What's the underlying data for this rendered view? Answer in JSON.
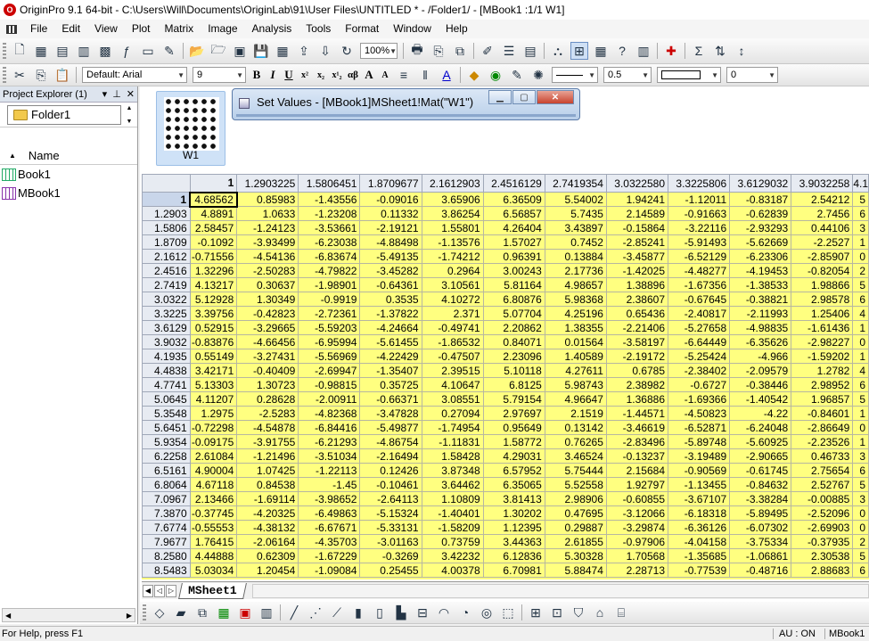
{
  "window": {
    "title": "OriginPro 9.1 64-bit - C:\\Users\\Will\\Documents\\OriginLab\\91\\User Files\\UNTITLED * - /Folder1/ - [MBook1 :1/1 W1]"
  },
  "menu": {
    "items": [
      "File",
      "Edit",
      "View",
      "Plot",
      "Matrix",
      "Image",
      "Analysis",
      "Tools",
      "Format",
      "Window",
      "Help"
    ]
  },
  "toolbar": {
    "zoom": "100%",
    "font": "Default: Arial",
    "font_size": "9",
    "line_width": "0.5",
    "combo_last": "0"
  },
  "project_explorer": {
    "title": "Project Explorer (1)",
    "folder": "Folder1",
    "column_header": "Name",
    "items": [
      {
        "name": "Book1",
        "type": "workbook"
      },
      {
        "name": "MBook1",
        "type": "matrixbook"
      }
    ]
  },
  "thumbnail": {
    "label": "W1"
  },
  "dialog": {
    "title": "Set Values - [MBook1]MSheet1!Mat(\"W1\")"
  },
  "matrix": {
    "column_headers": [
      "1",
      "1.2903225",
      "1.5806451",
      "1.8709677",
      "2.1612903",
      "2.4516129",
      "2.7419354",
      "3.0322580",
      "3.3225806",
      "3.6129032",
      "3.9032258",
      "4.1"
    ],
    "rows": [
      {
        "head": "1",
        "cells": [
          "4.68562",
          "0.85983",
          "-1.43556",
          "-0.09016",
          "3.65906",
          "6.36509",
          "5.54002",
          "1.94241",
          "-1.12011",
          "-0.83187",
          "2.54212",
          "5"
        ]
      },
      {
        "head": "1.2903",
        "cells": [
          "4.8891",
          "1.0633",
          "-1.23208",
          "0.11332",
          "3.86254",
          "6.56857",
          "5.7435",
          "2.14589",
          "-0.91663",
          "-0.62839",
          "2.7456",
          "6"
        ]
      },
      {
        "head": "1.5806",
        "cells": [
          "2.58457",
          "-1.24123",
          "-3.53661",
          "-2.19121",
          "1.55801",
          "4.26404",
          "3.43897",
          "-0.15864",
          "-3.22116",
          "-2.93293",
          "0.44106",
          "3"
        ]
      },
      {
        "head": "1.8709",
        "cells": [
          "-0.1092",
          "-3.93499",
          "-6.23038",
          "-4.88498",
          "-1.13576",
          "1.57027",
          "0.7452",
          "-2.85241",
          "-5.91493",
          "-5.62669",
          "-2.2527",
          "1"
        ]
      },
      {
        "head": "2.1612",
        "cells": [
          "-0.71556",
          "-4.54136",
          "-6.83674",
          "-5.49135",
          "-1.74212",
          "0.96391",
          "0.13884",
          "-3.45877",
          "-6.52129",
          "-6.23306",
          "-2.85907",
          "0"
        ]
      },
      {
        "head": "2.4516",
        "cells": [
          "1.32296",
          "-2.50283",
          "-4.79822",
          "-3.45282",
          "0.2964",
          "3.00243",
          "2.17736",
          "-1.42025",
          "-4.48277",
          "-4.19453",
          "-0.82054",
          "2"
        ]
      },
      {
        "head": "2.7419",
        "cells": [
          "4.13217",
          "0.30637",
          "-1.98901",
          "-0.64361",
          "3.10561",
          "5.81164",
          "4.98657",
          "1.38896",
          "-1.67356",
          "-1.38533",
          "1.98866",
          "5"
        ]
      },
      {
        "head": "3.0322",
        "cells": [
          "5.12928",
          "1.30349",
          "-0.9919",
          "0.3535",
          "4.10272",
          "6.80876",
          "5.98368",
          "2.38607",
          "-0.67645",
          "-0.38821",
          "2.98578",
          "6"
        ]
      },
      {
        "head": "3.3225",
        "cells": [
          "3.39756",
          "-0.42823",
          "-2.72361",
          "-1.37822",
          "2.371",
          "5.07704",
          "4.25196",
          "0.65436",
          "-2.40817",
          "-2.11993",
          "1.25406",
          "4"
        ]
      },
      {
        "head": "3.6129",
        "cells": [
          "0.52915",
          "-3.29665",
          "-5.59203",
          "-4.24664",
          "-0.49741",
          "2.20862",
          "1.38355",
          "-2.21406",
          "-5.27658",
          "-4.98835",
          "-1.61436",
          "1"
        ]
      },
      {
        "head": "3.9032",
        "cells": [
          "-0.83876",
          "-4.66456",
          "-6.95994",
          "-5.61455",
          "-1.86532",
          "0.84071",
          "0.01564",
          "-3.58197",
          "-6.64449",
          "-6.35626",
          "-2.98227",
          "0"
        ]
      },
      {
        "head": "4.1935",
        "cells": [
          "0.55149",
          "-3.27431",
          "-5.56969",
          "-4.22429",
          "-0.47507",
          "2.23096",
          "1.40589",
          "-2.19172",
          "-5.25424",
          "-4.966",
          "-1.59202",
          "1"
        ]
      },
      {
        "head": "4.4838",
        "cells": [
          "3.42171",
          "-0.40409",
          "-2.69947",
          "-1.35407",
          "2.39515",
          "5.10118",
          "4.27611",
          "0.6785",
          "-2.38402",
          "-2.09579",
          "1.2782",
          "4"
        ]
      },
      {
        "head": "4.7741",
        "cells": [
          "5.13303",
          "1.30723",
          "-0.98815",
          "0.35725",
          "4.10647",
          "6.8125",
          "5.98743",
          "2.38982",
          "-0.6727",
          "-0.38446",
          "2.98952",
          "6"
        ]
      },
      {
        "head": "5.0645",
        "cells": [
          "4.11207",
          "0.28628",
          "-2.00911",
          "-0.66371",
          "3.08551",
          "5.79154",
          "4.96647",
          "1.36886",
          "-1.69366",
          "-1.40542",
          "1.96857",
          "5"
        ]
      },
      {
        "head": "5.3548",
        "cells": [
          "1.2975",
          "-2.5283",
          "-4.82368",
          "-3.47828",
          "0.27094",
          "2.97697",
          "2.1519",
          "-1.44571",
          "-4.50823",
          "-4.22",
          "-0.84601",
          "1"
        ]
      },
      {
        "head": "5.6451",
        "cells": [
          "-0.72298",
          "-4.54878",
          "-6.84416",
          "-5.49877",
          "-1.74954",
          "0.95649",
          "0.13142",
          "-3.46619",
          "-6.52871",
          "-6.24048",
          "-2.86649",
          "0"
        ]
      },
      {
        "head": "5.9354",
        "cells": [
          "-0.09175",
          "-3.91755",
          "-6.21293",
          "-4.86754",
          "-1.11831",
          "1.58772",
          "0.76265",
          "-2.83496",
          "-5.89748",
          "-5.60925",
          "-2.23526",
          "1"
        ]
      },
      {
        "head": "6.2258",
        "cells": [
          "2.61084",
          "-1.21496",
          "-3.51034",
          "-2.16494",
          "1.58428",
          "4.29031",
          "3.46524",
          "-0.13237",
          "-3.19489",
          "-2.90665",
          "0.46733",
          "3"
        ]
      },
      {
        "head": "6.5161",
        "cells": [
          "4.90004",
          "1.07425",
          "-1.22113",
          "0.12426",
          "3.87348",
          "6.57952",
          "5.75444",
          "2.15684",
          "-0.90569",
          "-0.61745",
          "2.75654",
          "6"
        ]
      },
      {
        "head": "6.8064",
        "cells": [
          "4.67118",
          "0.84538",
          "-1.45",
          "-0.10461",
          "3.64462",
          "6.35065",
          "5.52558",
          "1.92797",
          "-1.13455",
          "-0.84632",
          "2.52767",
          "5"
        ]
      },
      {
        "head": "7.0967",
        "cells": [
          "2.13466",
          "-1.69114",
          "-3.98652",
          "-2.64113",
          "1.10809",
          "3.81413",
          "2.98906",
          "-0.60855",
          "-3.67107",
          "-3.38284",
          "-0.00885",
          "3"
        ]
      },
      {
        "head": "7.3870",
        "cells": [
          "-0.37745",
          "-4.20325",
          "-6.49863",
          "-5.15324",
          "-1.40401",
          "1.30202",
          "0.47695",
          "-3.12066",
          "-6.18318",
          "-5.89495",
          "-2.52096",
          "0"
        ]
      },
      {
        "head": "7.6774",
        "cells": [
          "-0.55553",
          "-4.38132",
          "-6.67671",
          "-5.33131",
          "-1.58209",
          "1.12395",
          "0.29887",
          "-3.29874",
          "-6.36126",
          "-6.07302",
          "-2.69903",
          "0"
        ]
      },
      {
        "head": "7.9677",
        "cells": [
          "1.76415",
          "-2.06164",
          "-4.35703",
          "-3.01163",
          "0.73759",
          "3.44363",
          "2.61855",
          "-0.97906",
          "-4.04158",
          "-3.75334",
          "-0.37935",
          "2"
        ]
      },
      {
        "head": "8.2580",
        "cells": [
          "4.44888",
          "0.62309",
          "-1.67229",
          "-0.3269",
          "3.42232",
          "6.12836",
          "5.30328",
          "1.70568",
          "-1.35685",
          "-1.06861",
          "2.30538",
          "5"
        ]
      },
      {
        "head": "8.5483",
        "cells": [
          "5.03034",
          "1.20454",
          "-1.09084",
          "0.25455",
          "4.00378",
          "6.70981",
          "5.88474",
          "2.28713",
          "-0.77539",
          "-0.48716",
          "2.88683",
          "6"
        ]
      }
    ]
  },
  "sheet_tab": "MSheet1",
  "status": {
    "help": "For Help, press F1",
    "au": "AU : ON",
    "book": "MBook1"
  }
}
